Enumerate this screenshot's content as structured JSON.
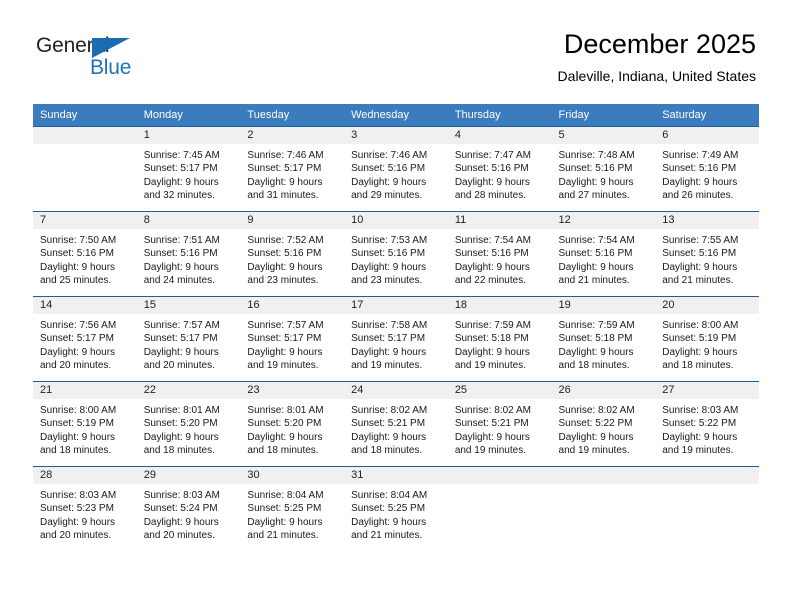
{
  "logo": {
    "text_top": "General",
    "text_bottom": "Blue",
    "top_color": "#231f20",
    "bottom_color": "#1b75bb",
    "triangle_color": "#1b6cb0"
  },
  "header": {
    "title": "December 2025",
    "subtitle": "Daleville, Indiana, United States"
  },
  "theme": {
    "header_band": "#3a7cbe",
    "header_text": "#ffffff",
    "daynum_band": "#f0f0f0",
    "row_divider": "#1f5c99",
    "body_text": "#1a1a1a"
  },
  "weekdays": [
    "Sunday",
    "Monday",
    "Tuesday",
    "Wednesday",
    "Thursday",
    "Friday",
    "Saturday"
  ],
  "weeks": [
    [
      {
        "day": "",
        "sunrise": "",
        "sunset": "",
        "daylight": "",
        "empty": true
      },
      {
        "day": "1",
        "sunrise": "Sunrise: 7:45 AM",
        "sunset": "Sunset: 5:17 PM",
        "daylight": "Daylight: 9 hours and 32 minutes.",
        "empty": false
      },
      {
        "day": "2",
        "sunrise": "Sunrise: 7:46 AM",
        "sunset": "Sunset: 5:17 PM",
        "daylight": "Daylight: 9 hours and 31 minutes.",
        "empty": false
      },
      {
        "day": "3",
        "sunrise": "Sunrise: 7:46 AM",
        "sunset": "Sunset: 5:16 PM",
        "daylight": "Daylight: 9 hours and 29 minutes.",
        "empty": false
      },
      {
        "day": "4",
        "sunrise": "Sunrise: 7:47 AM",
        "sunset": "Sunset: 5:16 PM",
        "daylight": "Daylight: 9 hours and 28 minutes.",
        "empty": false
      },
      {
        "day": "5",
        "sunrise": "Sunrise: 7:48 AM",
        "sunset": "Sunset: 5:16 PM",
        "daylight": "Daylight: 9 hours and 27 minutes.",
        "empty": false
      },
      {
        "day": "6",
        "sunrise": "Sunrise: 7:49 AM",
        "sunset": "Sunset: 5:16 PM",
        "daylight": "Daylight: 9 hours and 26 minutes.",
        "empty": false
      }
    ],
    [
      {
        "day": "7",
        "sunrise": "Sunrise: 7:50 AM",
        "sunset": "Sunset: 5:16 PM",
        "daylight": "Daylight: 9 hours and 25 minutes.",
        "empty": false
      },
      {
        "day": "8",
        "sunrise": "Sunrise: 7:51 AM",
        "sunset": "Sunset: 5:16 PM",
        "daylight": "Daylight: 9 hours and 24 minutes.",
        "empty": false
      },
      {
        "day": "9",
        "sunrise": "Sunrise: 7:52 AM",
        "sunset": "Sunset: 5:16 PM",
        "daylight": "Daylight: 9 hours and 23 minutes.",
        "empty": false
      },
      {
        "day": "10",
        "sunrise": "Sunrise: 7:53 AM",
        "sunset": "Sunset: 5:16 PM",
        "daylight": "Daylight: 9 hours and 23 minutes.",
        "empty": false
      },
      {
        "day": "11",
        "sunrise": "Sunrise: 7:54 AM",
        "sunset": "Sunset: 5:16 PM",
        "daylight": "Daylight: 9 hours and 22 minutes.",
        "empty": false
      },
      {
        "day": "12",
        "sunrise": "Sunrise: 7:54 AM",
        "sunset": "Sunset: 5:16 PM",
        "daylight": "Daylight: 9 hours and 21 minutes.",
        "empty": false
      },
      {
        "day": "13",
        "sunrise": "Sunrise: 7:55 AM",
        "sunset": "Sunset: 5:16 PM",
        "daylight": "Daylight: 9 hours and 21 minutes.",
        "empty": false
      }
    ],
    [
      {
        "day": "14",
        "sunrise": "Sunrise: 7:56 AM",
        "sunset": "Sunset: 5:17 PM",
        "daylight": "Daylight: 9 hours and 20 minutes.",
        "empty": false
      },
      {
        "day": "15",
        "sunrise": "Sunrise: 7:57 AM",
        "sunset": "Sunset: 5:17 PM",
        "daylight": "Daylight: 9 hours and 20 minutes.",
        "empty": false
      },
      {
        "day": "16",
        "sunrise": "Sunrise: 7:57 AM",
        "sunset": "Sunset: 5:17 PM",
        "daylight": "Daylight: 9 hours and 19 minutes.",
        "empty": false
      },
      {
        "day": "17",
        "sunrise": "Sunrise: 7:58 AM",
        "sunset": "Sunset: 5:17 PM",
        "daylight": "Daylight: 9 hours and 19 minutes.",
        "empty": false
      },
      {
        "day": "18",
        "sunrise": "Sunrise: 7:59 AM",
        "sunset": "Sunset: 5:18 PM",
        "daylight": "Daylight: 9 hours and 19 minutes.",
        "empty": false
      },
      {
        "day": "19",
        "sunrise": "Sunrise: 7:59 AM",
        "sunset": "Sunset: 5:18 PM",
        "daylight": "Daylight: 9 hours and 18 minutes.",
        "empty": false
      },
      {
        "day": "20",
        "sunrise": "Sunrise: 8:00 AM",
        "sunset": "Sunset: 5:19 PM",
        "daylight": "Daylight: 9 hours and 18 minutes.",
        "empty": false
      }
    ],
    [
      {
        "day": "21",
        "sunrise": "Sunrise: 8:00 AM",
        "sunset": "Sunset: 5:19 PM",
        "daylight": "Daylight: 9 hours and 18 minutes.",
        "empty": false
      },
      {
        "day": "22",
        "sunrise": "Sunrise: 8:01 AM",
        "sunset": "Sunset: 5:20 PM",
        "daylight": "Daylight: 9 hours and 18 minutes.",
        "empty": false
      },
      {
        "day": "23",
        "sunrise": "Sunrise: 8:01 AM",
        "sunset": "Sunset: 5:20 PM",
        "daylight": "Daylight: 9 hours and 18 minutes.",
        "empty": false
      },
      {
        "day": "24",
        "sunrise": "Sunrise: 8:02 AM",
        "sunset": "Sunset: 5:21 PM",
        "daylight": "Daylight: 9 hours and 18 minutes.",
        "empty": false
      },
      {
        "day": "25",
        "sunrise": "Sunrise: 8:02 AM",
        "sunset": "Sunset: 5:21 PM",
        "daylight": "Daylight: 9 hours and 19 minutes.",
        "empty": false
      },
      {
        "day": "26",
        "sunrise": "Sunrise: 8:02 AM",
        "sunset": "Sunset: 5:22 PM",
        "daylight": "Daylight: 9 hours and 19 minutes.",
        "empty": false
      },
      {
        "day": "27",
        "sunrise": "Sunrise: 8:03 AM",
        "sunset": "Sunset: 5:22 PM",
        "daylight": "Daylight: 9 hours and 19 minutes.",
        "empty": false
      }
    ],
    [
      {
        "day": "28",
        "sunrise": "Sunrise: 8:03 AM",
        "sunset": "Sunset: 5:23 PM",
        "daylight": "Daylight: 9 hours and 20 minutes.",
        "empty": false
      },
      {
        "day": "29",
        "sunrise": "Sunrise: 8:03 AM",
        "sunset": "Sunset: 5:24 PM",
        "daylight": "Daylight: 9 hours and 20 minutes.",
        "empty": false
      },
      {
        "day": "30",
        "sunrise": "Sunrise: 8:04 AM",
        "sunset": "Sunset: 5:25 PM",
        "daylight": "Daylight: 9 hours and 21 minutes.",
        "empty": false
      },
      {
        "day": "31",
        "sunrise": "Sunrise: 8:04 AM",
        "sunset": "Sunset: 5:25 PM",
        "daylight": "Daylight: 9 hours and 21 minutes.",
        "empty": false
      },
      {
        "day": "",
        "sunrise": "",
        "sunset": "",
        "daylight": "",
        "empty": true
      },
      {
        "day": "",
        "sunrise": "",
        "sunset": "",
        "daylight": "",
        "empty": true
      },
      {
        "day": "",
        "sunrise": "",
        "sunset": "",
        "daylight": "",
        "empty": true
      }
    ]
  ]
}
